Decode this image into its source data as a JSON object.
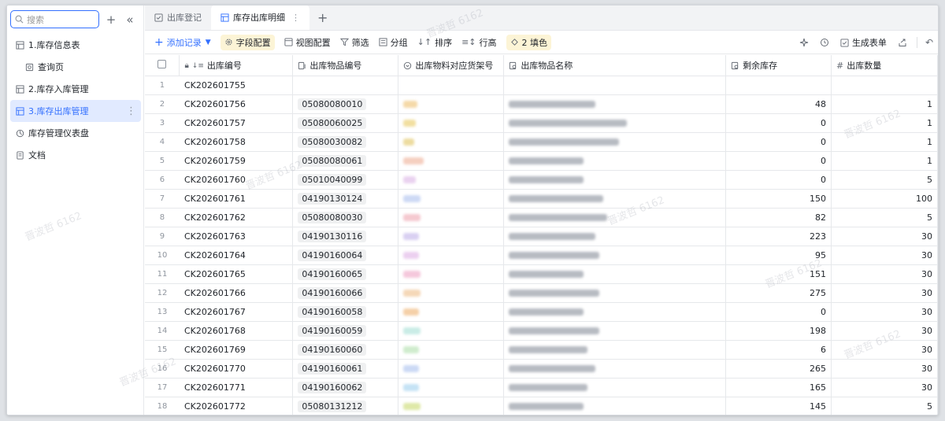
{
  "sidebar": {
    "search_placeholder": "搜索",
    "items": [
      {
        "label": "1.库存信息表"
      },
      {
        "label": "查询页"
      },
      {
        "label": "2.库存入库管理"
      },
      {
        "label": "3.库存出库管理"
      },
      {
        "label": "库存管理仪表盘"
      },
      {
        "label": "文档"
      }
    ]
  },
  "tabs": [
    {
      "label": "出库登记"
    },
    {
      "label": "库存出库明细"
    }
  ],
  "toolbar": {
    "add": "添加记录",
    "fields": "字段配置",
    "view": "视图配置",
    "filter": "筛选",
    "group": "分组",
    "sort": "排序",
    "row_height": "行高",
    "fill": "2 填色",
    "generate_form": "生成表单"
  },
  "columns": {
    "c1": "出库编号",
    "c2": "出库物品编号",
    "c3": "出库物料对应货架号",
    "c4": "出库物品名称",
    "c5": "剩余库存",
    "c6": "出库数量"
  },
  "rows": [
    {
      "n": "1",
      "id": "CK202601755",
      "item": "",
      "stock": "",
      "qty": ""
    },
    {
      "n": "2",
      "id": "CK202601756",
      "item": "05080080010",
      "stock": "48",
      "qty": "1"
    },
    {
      "n": "3",
      "id": "CK202601757",
      "item": "05080060025",
      "stock": "0",
      "qty": "1"
    },
    {
      "n": "4",
      "id": "CK202601758",
      "item": "05080030082",
      "stock": "0",
      "qty": "1"
    },
    {
      "n": "5",
      "id": "CK202601759",
      "item": "05080080061",
      "stock": "0",
      "qty": "1"
    },
    {
      "n": "6",
      "id": "CK202601760",
      "item": "05010040099",
      "stock": "0",
      "qty": "5"
    },
    {
      "n": "7",
      "id": "CK202601761",
      "item": "04190130124",
      "stock": "150",
      "qty": "100"
    },
    {
      "n": "8",
      "id": "CK202601762",
      "item": "05080080030",
      "stock": "82",
      "qty": "5"
    },
    {
      "n": "9",
      "id": "CK202601763",
      "item": "04190130116",
      "stock": "223",
      "qty": "30"
    },
    {
      "n": "10",
      "id": "CK202601764",
      "item": "04190160064",
      "stock": "95",
      "qty": "30"
    },
    {
      "n": "11",
      "id": "CK202601765",
      "item": "04190160065",
      "stock": "151",
      "qty": "30"
    },
    {
      "n": "12",
      "id": "CK202601766",
      "item": "04190160066",
      "stock": "275",
      "qty": "30"
    },
    {
      "n": "13",
      "id": "CK202601767",
      "item": "04190160058",
      "stock": "0",
      "qty": "30"
    },
    {
      "n": "14",
      "id": "CK202601768",
      "item": "04190160059",
      "stock": "198",
      "qty": "30"
    },
    {
      "n": "15",
      "id": "CK202601769",
      "item": "04190160060",
      "stock": "6",
      "qty": "30"
    },
    {
      "n": "16",
      "id": "CK202601770",
      "item": "04190160061",
      "stock": "265",
      "qty": "30"
    },
    {
      "n": "17",
      "id": "CK202601771",
      "item": "04190160062",
      "stock": "165",
      "qty": "30"
    },
    {
      "n": "18",
      "id": "CK202601772",
      "item": "05080131212",
      "stock": "145",
      "qty": "5"
    }
  ],
  "shelf_colors": [
    "",
    "#f5d9a8",
    "#f2dfa0",
    "#eddca0",
    "#f5cfc0",
    "#ead2f0",
    "#cdd9f5",
    "#f5c9d0",
    "#d9d0f2",
    "#ecd0f0",
    "#f5c8dc",
    "#f5d8b8",
    "#f5d0a8",
    "#c9ece6",
    "#cfeccd",
    "#cbd9f5",
    "#c5e3f5",
    "#dfe9a8"
  ],
  "watermark": "晋波哲 6162"
}
